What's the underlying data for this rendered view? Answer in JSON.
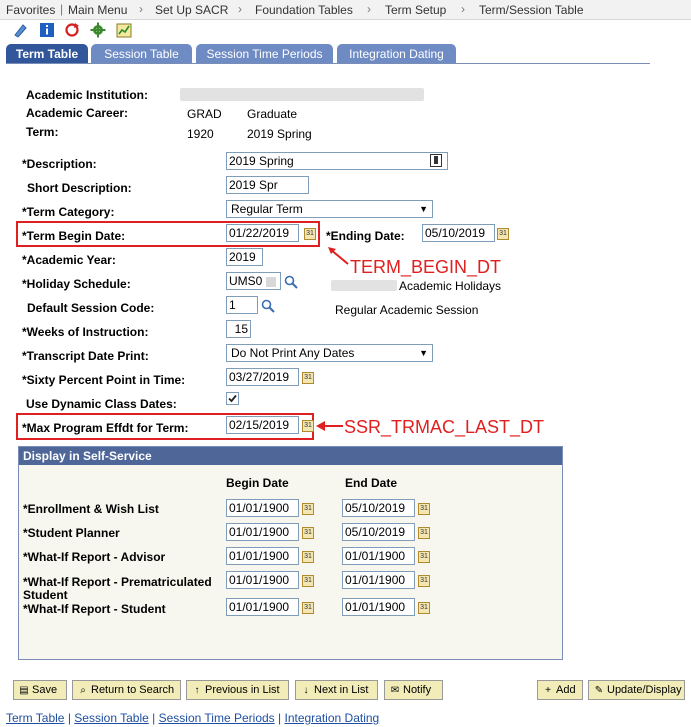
{
  "breadcrumb": {
    "items": [
      "Favorites",
      "Main Menu",
      "Set Up SACR",
      "Foundation Tables",
      "Term Setup",
      "Term/Session Table"
    ]
  },
  "toolbar": {
    "icons": [
      "pencil-icon",
      "info-icon",
      "refresh-icon",
      "gear-icon",
      "chart-icon"
    ]
  },
  "tabs": [
    {
      "label": "Term Table",
      "active": true
    },
    {
      "label": "Session Table",
      "active": false
    },
    {
      "label": "Session Time Periods",
      "active": false
    },
    {
      "label": "Integration Dating",
      "active": false
    }
  ],
  "header": {
    "institution_label": "Academic Institution:",
    "career_label": "Academic Career:",
    "career_code": "GRAD",
    "career_desc": "Graduate",
    "term_label": "Term:",
    "term_code": "1920",
    "term_desc": "2019 Spring"
  },
  "form": {
    "description_label": "*Description:",
    "description_value": "2019 Spring",
    "short_desc_label": "Short Description:",
    "short_desc_value": "2019 Spr",
    "term_category_label": "*Term Category:",
    "term_category_value": "Regular Term",
    "term_begin_label": "*Term Begin Date:",
    "term_begin_value": "01/22/2019",
    "ending_date_label": "*Ending Date:",
    "ending_date_value": "05/10/2019",
    "academic_year_label": "*Academic Year:",
    "academic_year_value": "2019",
    "holiday_label": "*Holiday Schedule:",
    "holiday_value": "UMS0",
    "holiday_desc": "Academic Holidays",
    "session_code_label": "Default Session Code:",
    "session_code_value": "1",
    "session_code_desc": "Regular Academic Session",
    "weeks_label": "*Weeks of Instruction:",
    "weeks_value": "15",
    "transcript_label": "*Transcript Date Print:",
    "transcript_value": "Do Not Print Any Dates",
    "sixty_label": "*Sixty Percent Point in Time:",
    "sixty_value": "03/27/2019",
    "dynamic_label": "Use Dynamic Class Dates:",
    "max_program_label": "*Max Program Effdt for Term:",
    "max_program_value": "02/15/2019"
  },
  "annotations": {
    "term_begin_dt": "TERM_BEGIN_DT",
    "trmac_last_dt": "SSR_TRMAC_LAST_DT"
  },
  "self_service": {
    "title": "Display in Self-Service",
    "begin_header": "Begin Date",
    "end_header": "End Date",
    "rows": [
      {
        "label": "*Enrollment & Wish List",
        "begin": "01/01/1900",
        "end": "05/10/2019"
      },
      {
        "label": "*Student Planner",
        "begin": "01/01/1900",
        "end": "05/10/2019"
      },
      {
        "label": "*What-If Report - Advisor",
        "begin": "01/01/1900",
        "end": "01/01/1900"
      },
      {
        "label": "*What-If Report - Prematriculated",
        "label2": "Student",
        "begin": "01/01/1900",
        "end": "01/01/1900"
      },
      {
        "label": "*What-If Report - Student",
        "begin": "01/01/1900",
        "end": "01/01/1900"
      }
    ]
  },
  "buttons": {
    "save": "Save",
    "return": "Return to Search",
    "previous": "Previous in List",
    "next": "Next in List",
    "notify": "Notify",
    "add": "Add",
    "update": "Update/Display"
  },
  "footer_links": [
    "Term Table",
    "Session Table",
    "Session Time Periods",
    "Integration Dating"
  ],
  "colors": {
    "tab_active": "#31569a",
    "tab_inactive": "#6f8bc4",
    "annotation": "#e02020",
    "panel_header": "#4f6698"
  }
}
